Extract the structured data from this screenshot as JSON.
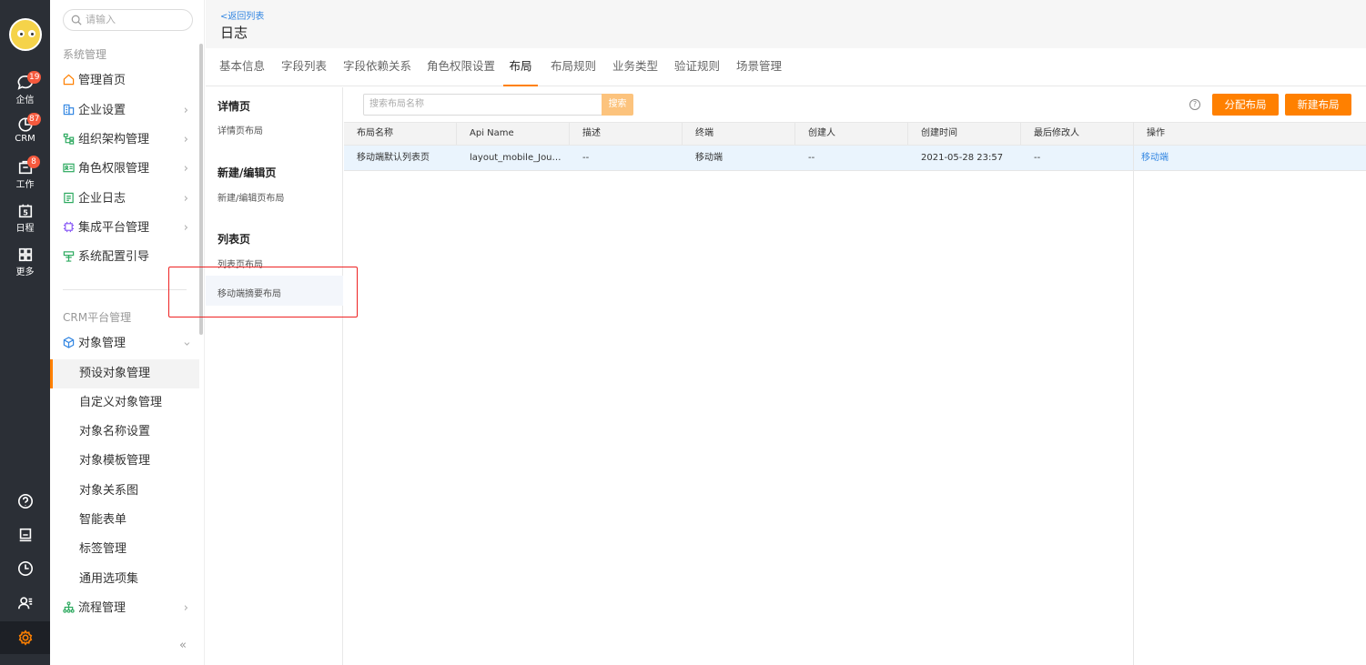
{
  "rail": {
    "items": [
      {
        "label": "企信",
        "badge": "19"
      },
      {
        "label": "CRM",
        "badge": "87"
      },
      {
        "label": "工作",
        "badge": "8"
      },
      {
        "label": "日程",
        "day": "5"
      },
      {
        "label": "更多"
      }
    ]
  },
  "nav": {
    "search_placeholder": "请输入",
    "section1": "系统管理",
    "items": [
      "管理首页",
      "企业设置",
      "组织架构管理",
      "角色权限管理",
      "企业日志",
      "集成平台管理",
      "系统配置引导"
    ],
    "section2": "CRM平台管理",
    "object_mgmt": "对象管理",
    "sub_items": [
      "预设对象管理",
      "自定义对象管理",
      "对象名称设置",
      "对象模板管理",
      "对象关系图",
      "智能表单",
      "标签管理",
      "通用选项集"
    ],
    "flow_mgmt": "流程管理",
    "collapse": "«"
  },
  "header": {
    "back": "<返回列表",
    "title": "日志"
  },
  "tabs": [
    "基本信息",
    "字段列表",
    "字段依赖关系",
    "角色权限设置",
    "布局",
    "布局规则",
    "业务类型",
    "验证规则",
    "场景管理"
  ],
  "left_panel": {
    "groups": [
      {
        "title": "详情页",
        "items": [
          "详情页布局"
        ]
      },
      {
        "title": "新建/编辑页",
        "items": [
          "新建/编辑页布局"
        ]
      },
      {
        "title": "列表页",
        "items": [
          "列表页布局",
          "移动端摘要布局"
        ]
      }
    ]
  },
  "toolbar": {
    "search_placeholder": "搜索布局名称",
    "search_btn": "搜索",
    "help": "?",
    "assign_btn": "分配布局",
    "new_btn": "新建布局"
  },
  "table": {
    "headers": [
      "布局名称",
      "Api Name",
      "描述",
      "终端",
      "创建人",
      "创建时间",
      "最后修改人",
      "操作"
    ],
    "rows": [
      [
        "移动端默认列表页",
        "layout_mobile_Journ...",
        "--",
        "移动端",
        "--",
        "2021-05-28 23:57",
        "--",
        "移动端"
      ]
    ]
  },
  "colors": {
    "accent": "#ff8000",
    "link": "#3487e2",
    "rail": "#2b2f36",
    "highlight_box": "#ee2222"
  }
}
